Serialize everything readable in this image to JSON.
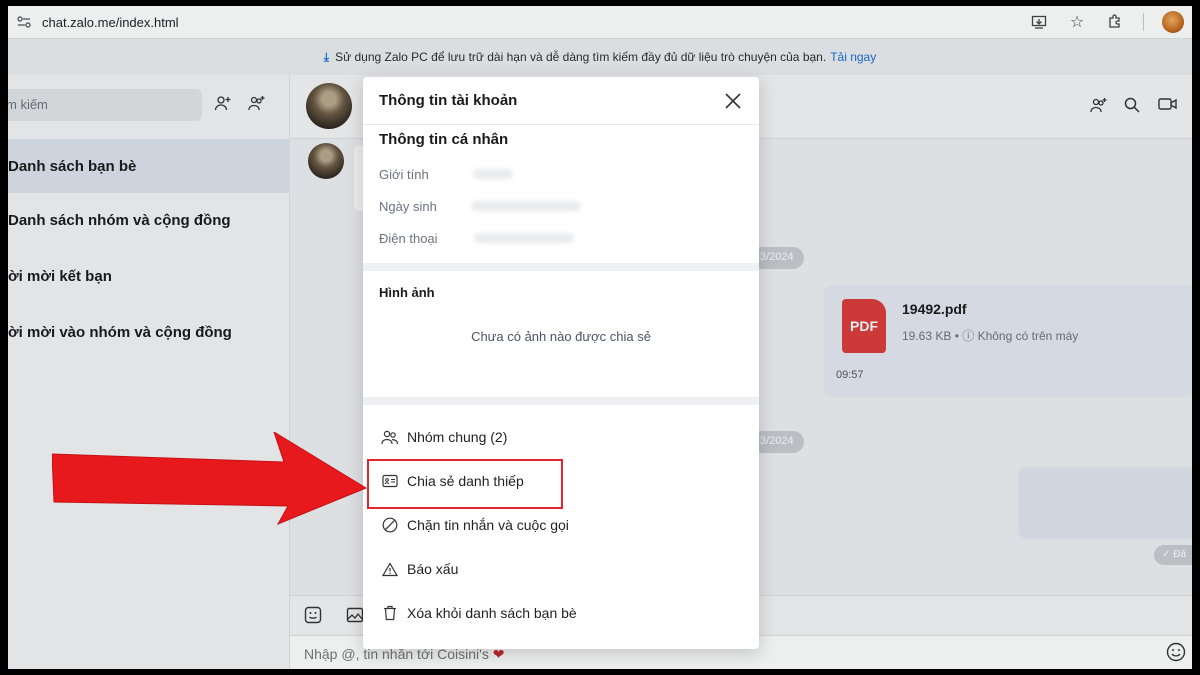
{
  "browser": {
    "url": "chat.zalo.me/index.html",
    "site_icon": "site-settings-icon",
    "right_icons": [
      "install-app-icon",
      "bookmark-star-icon",
      "extensions-icon",
      "profile-avatar"
    ]
  },
  "banner": {
    "text": "Sử dụng Zalo PC để lưu trữ dài hạn và dễ dàng tìm kiếm đầy đủ dữ liệu trò chuyện của bạn.",
    "link": "Tải ngay",
    "icon": "download-icon",
    "icon_glyph": "⤓"
  },
  "sidebar": {
    "search_placeholder": "m kiếm",
    "items": [
      {
        "label": "Danh sách bạn bè"
      },
      {
        "label": "Danh sách nhóm và cộng đồng"
      },
      {
        "label": "Lời mời kết bạn"
      },
      {
        "label": "Lời mời vào nhóm và cộng đồng"
      }
    ],
    "item_visible": [
      "Danh sách bạn bè",
      "Danh sách nhóm và cộng đồng",
      "ời mời kết bạn",
      "ời mời vào nhóm và cộng đồng"
    ]
  },
  "chat": {
    "date_pill_1": "3/2024",
    "date_pill_2": "3/2024",
    "file": {
      "icon_label": "PDF",
      "name": "19492.pdf",
      "meta": "19.63 KB • ⓘ Không có trên máy",
      "time": "09:57"
    },
    "sent_label": "✓ Đã",
    "composer_placeholder": "Nhập @, tin nhắn tới Coisini's",
    "composer_heart": "❤"
  },
  "modal": {
    "title": "Thông tin tài khoản",
    "close_glyph": "✕",
    "personal_title": "Thông tin cá nhân",
    "rows": [
      {
        "label": "Giới tính"
      },
      {
        "label": "Ngày sinh"
      },
      {
        "label": "Điện thoại"
      }
    ],
    "photos_title": "Hình ảnh",
    "photos_empty": "Chưa có ảnh nào được chia sẻ",
    "actions": [
      {
        "label": "Nhóm chung (2)",
        "icon": "group-icon"
      },
      {
        "label": "Chia sẻ danh thiếp",
        "icon": "business-card-icon"
      },
      {
        "label": "Chặn tin nhắn và cuộc gọi",
        "icon": "block-icon"
      },
      {
        "label": "Báo xấu",
        "icon": "warning-icon"
      },
      {
        "label": "Xóa khỏi danh sách bạn bè",
        "icon": "trash-icon"
      }
    ]
  },
  "colors": {
    "accent_blue": "#1a6fd6",
    "highlight_red": "#e0282e",
    "arrow_red": "#e8191c",
    "pdf_red": "#dc3b3b"
  }
}
